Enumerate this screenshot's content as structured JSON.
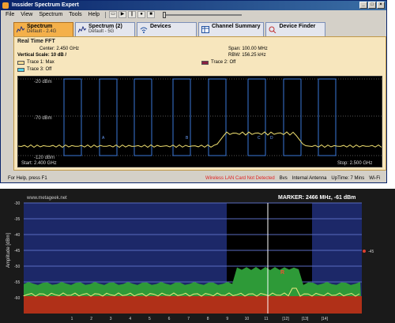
{
  "window": {
    "title": "Inssider Spectrum Expert",
    "menus": [
      "File",
      "View",
      "Spectrum",
      "Tools",
      "Help"
    ]
  },
  "tabs": [
    {
      "title": "Spectrum",
      "sub": "Default - 2.4G",
      "active": true,
      "icon": "spectrum-icon"
    },
    {
      "title": "Spectrum (2)",
      "sub": "Default - 5G",
      "active": false,
      "icon": "spectrum-icon"
    },
    {
      "title": "Devices",
      "sub": "",
      "active": false,
      "icon": "wifi-icon"
    },
    {
      "title": "Channel Summary",
      "sub": "",
      "active": false,
      "icon": "table-icon"
    },
    {
      "title": "Device Finder",
      "sub": "",
      "active": false,
      "icon": "finder-icon"
    }
  ],
  "panel": {
    "title": "Real Time FFT",
    "center": "Center: 2.450 GHz",
    "vscale": "Vertical Scale: 10 dB /",
    "span": "Span: 100.00 MHz",
    "rbw": "RBW: 156.25 kHz",
    "trace1": "Trace 1: Max",
    "trace2": "Trace 2: Off",
    "trace3": "Trace 3: Off",
    "trace1_color": "#f0d890",
    "trace2_color": "#8a2040",
    "trace3_color": "#4fd0e8"
  },
  "fft_chart": {
    "y_top": "-20 dBm",
    "y_mid": "-70 dBm",
    "y_bottom": "-120 dBm",
    "start": "Start: 2.400 GHz",
    "stop": "Stop: 2.500 GHz",
    "markers": [
      "A",
      "B",
      "C",
      "D"
    ],
    "line_color": "#3a78d8",
    "trace_color": "#f0e070"
  },
  "statusbar": {
    "help": "For Help, press F1",
    "warning": "Wireless LAN Card Not Detected",
    "b": "Bvs",
    "antenna": "Internal Antenna",
    "uptime": "UpTime: 7 Mins",
    "wifi": "Wi-Fi"
  },
  "lower_chart": {
    "watermark": "www.metageek.net",
    "marker": "MARKER: 2466 MHz, -61 dBm",
    "ylabel": "Amplitude [dBm]",
    "y_ticks": [
      "-30",
      "-35",
      "-40",
      "-45",
      "-50",
      "-55",
      "-60"
    ],
    "x_ticks": [
      "1",
      "2",
      "3",
      "4",
      "5",
      "6",
      "7",
      "8",
      "9",
      "10",
      "11",
      "[12]",
      "[13]",
      "[14]"
    ],
    "marker_label": "R",
    "right_label": "-45",
    "bg_color": "#1c2868",
    "green_color": "#2e9a38",
    "red_color": "#b03018"
  }
}
